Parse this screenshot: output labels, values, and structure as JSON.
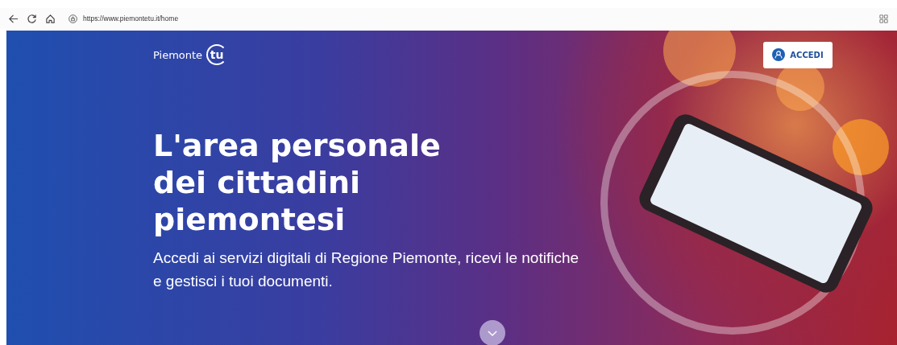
{
  "browser": {
    "url": "https://www.piemontetu.it/home"
  },
  "header": {
    "logo_text": "Piemonte",
    "logo_mark": "tu",
    "login_button": "ACCEDI"
  },
  "hero": {
    "title": "L'area personale dei cittadini piemontesi",
    "subtitle": "Accedi ai servizi digitali di Regione Piemonte, ricevi le notifiche e gestisci i tuoi documenti."
  }
}
